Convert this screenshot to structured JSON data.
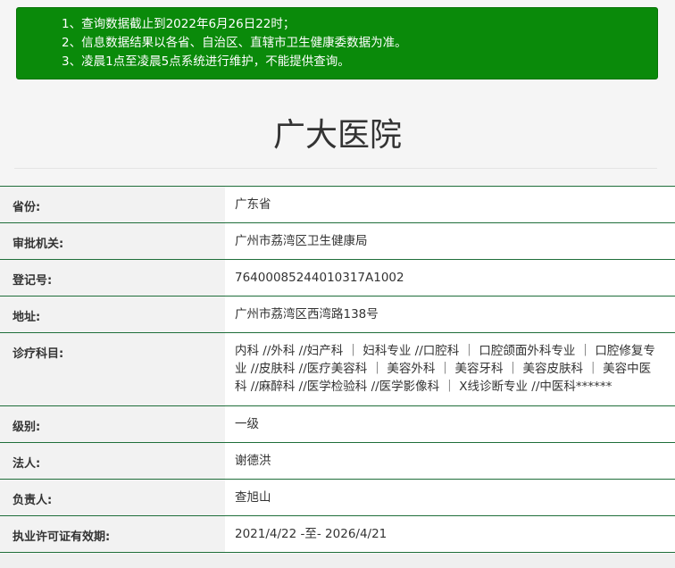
{
  "notice": {
    "lines": [
      "1、查询数据截止到2022年6月26日22时；",
      "2、信息数据结果以各省、自治区、直辖市卫生健康委数据为准。",
      "3、凌晨1点至凌晨5点系统进行维护，不能提供查询。"
    ],
    "background_color": "#0a8a0a"
  },
  "hospital": {
    "name": "广大医院"
  },
  "fields": [
    {
      "label": "省份:",
      "value": "广东省"
    },
    {
      "label": "审批机关:",
      "value": "广州市荔湾区卫生健康局"
    },
    {
      "label": "登记号:",
      "value": "76400085244010317A1002"
    },
    {
      "label": "地址:",
      "value": "广州市荔湾区西湾路138号"
    },
    {
      "label": "诊疗科目:",
      "value": "内科 //外科 //妇产科 ｜ 妇科专业 //口腔科 ｜ 口腔颌面外科专业 ｜ 口腔修复专业 //皮肤科 //医疗美容科 ｜ 美容外科 ｜ 美容牙科 ｜ 美容皮肤科 ｜ 美容中医科 //麻醉科 //医学检验科 //医学影像科 ｜ X线诊断专业 //中医科******"
    },
    {
      "label": "级别:",
      "value": "一级"
    },
    {
      "label": "法人:",
      "value": "谢德洪"
    },
    {
      "label": "负责人:",
      "value": "查旭山"
    },
    {
      "label": "执业许可证有效期:",
      "value": "2021/4/22 -至- 2026/4/21"
    }
  ],
  "colors": {
    "row_border": "#1f6e3a",
    "label_bg": "#f2f2f2",
    "value_bg": "#ffffff"
  }
}
